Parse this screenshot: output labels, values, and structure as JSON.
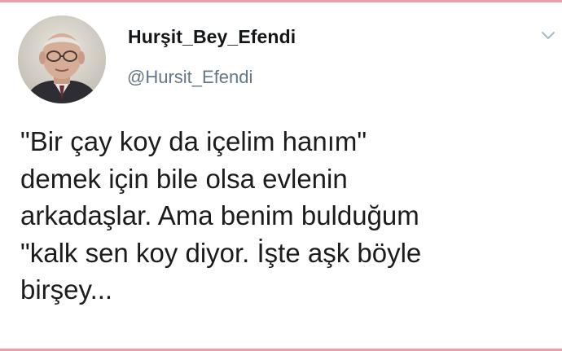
{
  "tweet": {
    "display_name": "Hurşit_Bey_Efendi",
    "handle": "@Hursit_Efendi",
    "text_lines": [
      "\"Bir çay koy da içelim hanım\"",
      "demek için bile olsa evlenin",
      "arkadaşlar. Ama benim bulduğum",
      "\"kalk sen koy diyor. İşte aşk böyle",
      "birşey..."
    ],
    "caret_icon": "chevron-down-icon",
    "avatar_icon": "avatar"
  },
  "colors": {
    "name": "#14171a",
    "handle": "#657786",
    "text": "#1c1c1c",
    "frame_accent": "#e8a0a8",
    "caret": "#aab8c2"
  }
}
